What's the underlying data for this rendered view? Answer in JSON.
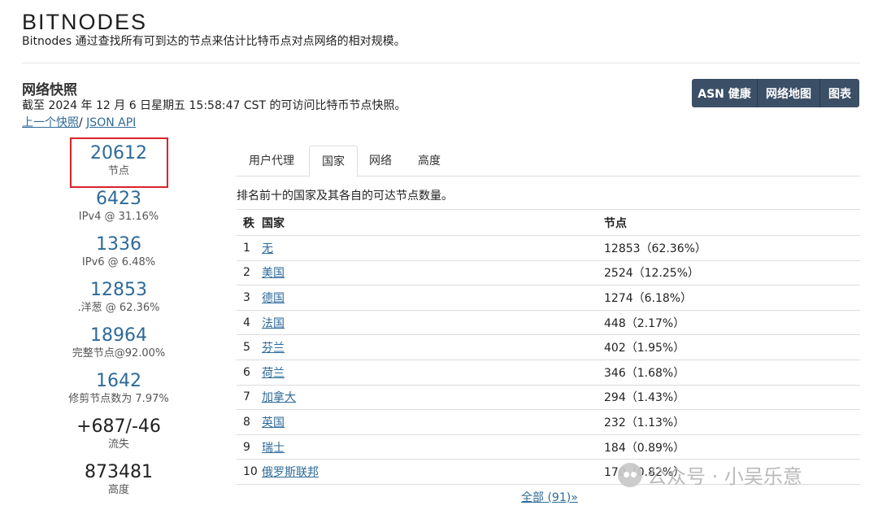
{
  "header": {
    "logo": "BITNODES",
    "tagline": "Bitnodes 通过查找所有可到达的节点来估计比特币点对点网络的相对规模。"
  },
  "snapshot": {
    "title": "网络快照",
    "description": "截至 2024 年 12 月 6 日星期五 15:58:47 CST 的可访问比特币节点快照。",
    "prev_link": "上一个快照",
    "separator": "/",
    "json_link": "JSON API"
  },
  "buttons": {
    "asn": "ASN 健康",
    "map": "网络地图",
    "charts": "图表"
  },
  "stats": [
    {
      "value": "20612",
      "label": "节点"
    },
    {
      "value": "6423",
      "label": "IPv4 @ 31.16%"
    },
    {
      "value": "1336",
      "label": "IPv6 @ 6.48%"
    },
    {
      "value": "12853",
      "label": ".洋葱 @ 62.36%"
    },
    {
      "value": "18964",
      "label": "完整节点@92.00%"
    },
    {
      "value": "1642",
      "label": "修剪节点数为 7.97%"
    },
    {
      "value": "+687/-46",
      "label": "流失"
    },
    {
      "value": "873481",
      "label": "高度"
    }
  ],
  "tabs": [
    "用户代理",
    "国家",
    "网络",
    "高度"
  ],
  "active_tab": "国家",
  "table": {
    "caption": "排名前十的国家及其各自的可达节点数量。",
    "headers": {
      "rank": "秩",
      "country": "国家",
      "nodes": "节点"
    },
    "rows": [
      {
        "rank": "1",
        "country": "无",
        "nodes": "12853（62.36%）"
      },
      {
        "rank": "2",
        "country": "美国",
        "nodes": "2524（12.25%）"
      },
      {
        "rank": "3",
        "country": "德国",
        "nodes": "1274（6.18%）"
      },
      {
        "rank": "4",
        "country": "法国",
        "nodes": "448（2.17%）"
      },
      {
        "rank": "5",
        "country": "芬兰",
        "nodes": "402（1.95%）"
      },
      {
        "rank": "6",
        "country": "荷兰",
        "nodes": "346（1.68%）"
      },
      {
        "rank": "7",
        "country": "加拿大",
        "nodes": "294（1.43%）"
      },
      {
        "rank": "8",
        "country": "英国",
        "nodes": "232（1.13%）"
      },
      {
        "rank": "9",
        "country": "瑞士",
        "nodes": "184（0.89%）"
      },
      {
        "rank": "10",
        "country": "俄罗斯联邦",
        "nodes": "170（0.82%）"
      }
    ],
    "all_link": "全部 (91)»"
  },
  "watermark": "公众号 · 小吴乐意",
  "colors": {
    "link": "#2d6a99",
    "button_bg": "#3b4f66",
    "highlight_box": "#d8232a"
  }
}
